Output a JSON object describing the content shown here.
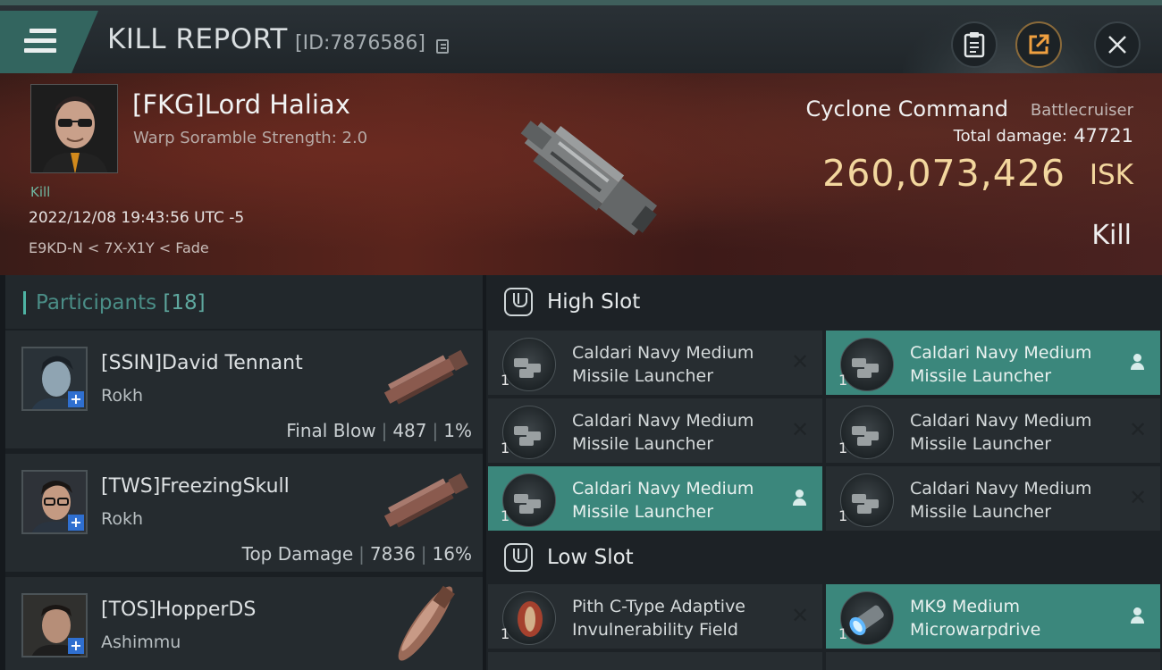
{
  "header": {
    "title": "KILL REPORT",
    "report_id": "[ID:7876586]",
    "icons": [
      "menu-icon",
      "copy-icon",
      "clipboard-icon",
      "share-icon",
      "close-icon"
    ]
  },
  "victim": {
    "name": "[FKG]Lord Haliax",
    "scramble": "Warp Soramble Strength: 2.0",
    "tag": "Kill",
    "time": "2022/12/08 19:43:56 UTC -5",
    "location": "E9KD-N < 7X-X1Y < Fade",
    "ship_name": "Cyclone Command",
    "ship_class": "Battlecruiser",
    "total_damage_label": "Total damage:",
    "total_damage": "47721",
    "isk_value": "260,073,426",
    "isk_unit": "ISK",
    "result": "Kill"
  },
  "participants": {
    "title": "Participants",
    "count": "[18]",
    "rows": [
      {
        "name": "[SSIN]David Tennant",
        "ship": "Rokh",
        "role": "Final Blow",
        "damage": "487",
        "percent": "1%"
      },
      {
        "name": "[TWS]FreezingSkull",
        "ship": "Rokh",
        "role": "Top Damage",
        "damage": "7836",
        "percent": "16%"
      },
      {
        "name": "[TOS]HopperDS",
        "ship": "Ashimmu",
        "role": "",
        "damage": "",
        "percent": ""
      }
    ]
  },
  "slots": {
    "high": {
      "title": "High Slot",
      "modules": [
        {
          "name": "Caldari Navy Medium Missile Launcher",
          "qty": "1",
          "state": "destroyed"
        },
        {
          "name": "Caldari Navy Medium Missile Launcher",
          "qty": "1",
          "state": "dropped"
        },
        {
          "name": "Caldari Navy Medium Missile Launcher",
          "qty": "1",
          "state": "destroyed"
        },
        {
          "name": "Caldari Navy Medium Missile Launcher",
          "qty": "1",
          "state": "destroyed"
        },
        {
          "name": "Caldari Navy Medium Missile Launcher",
          "qty": "1",
          "state": "dropped"
        },
        {
          "name": "Caldari Navy Medium Missile Launcher",
          "qty": "1",
          "state": "destroyed"
        }
      ]
    },
    "low": {
      "title": "Low Slot",
      "modules": [
        {
          "name": "Pith C-Type Adaptive Invulnerability Field",
          "qty": "1",
          "state": "destroyed"
        },
        {
          "name": "MK9 Medium Microwarpdrive",
          "qty": "1",
          "state": "dropped"
        }
      ]
    }
  },
  "colors": {
    "accent": "#3b877c",
    "isk": "#f3d79e",
    "banner": "#5a241c"
  }
}
